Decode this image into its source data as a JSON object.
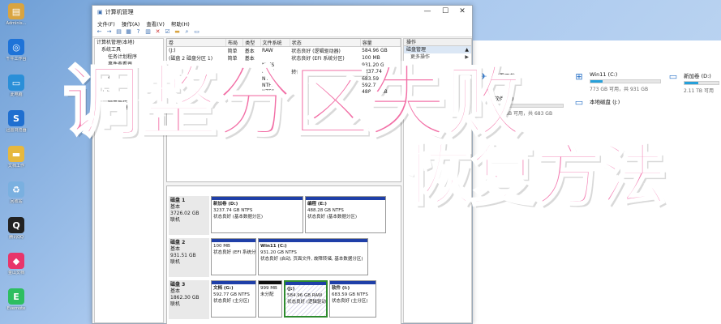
{
  "desktop_icons": [
    {
      "label": "Adminis...",
      "icon": "user-folder-icon",
      "color": "#d9a441",
      "glyph": "▤"
    },
    {
      "label": "千牛工作台",
      "icon": "qianniu-icon",
      "color": "#1e73d8",
      "glyph": "◎"
    },
    {
      "label": "此电脑",
      "icon": "computer-icon",
      "color": "#2a8fd8",
      "glyph": "▭"
    },
    {
      "label": "迅雷浏览器",
      "icon": "xunlei-browser-icon",
      "color": "#1f6fd0",
      "glyph": "S"
    },
    {
      "label": "文档工作",
      "icon": "folder-icon",
      "color": "#e6b83f",
      "glyph": "▬"
    },
    {
      "label": "回收站",
      "icon": "recycle-bin-icon",
      "color": "#7ab0e0",
      "glyph": "♻"
    },
    {
      "label": "腾讯QQ",
      "icon": "qq-icon",
      "color": "#222222",
      "glyph": "Q"
    },
    {
      "label": "金山文档",
      "icon": "kingsoft-docs-icon",
      "color": "#e8356b",
      "glyph": "◆"
    },
    {
      "label": "Evernote",
      "icon": "evernote-icon",
      "color": "#2dbe60",
      "glyph": "E"
    }
  ],
  "explorer": {
    "drives": [
      {
        "name": "迅雷下载",
        "capacity": "",
        "fill": 0,
        "icon": "xunlei-icon"
      },
      {
        "name": "Win11 (C:)",
        "capacity": "773 GB 可用，共 931 GB",
        "fill": 0.17,
        "icon": "windows-drive-icon"
      },
      {
        "name": "新加卷 (D:)",
        "capacity": "2.11 TB 可用",
        "fill": 0.4,
        "icon": "drive-icon"
      },
      {
        "name": "软件 (I:)",
        "capacity": "660 GB 可用，共 683 GB",
        "fill": 0.04,
        "icon": "drive-icon"
      },
      {
        "name": "本地磁盘 (J:)",
        "capacity": "",
        "fill": 0,
        "icon": "drive-icon"
      }
    ]
  },
  "window": {
    "title": "计算机管理",
    "menu": [
      "文件(F)",
      "操作(A)",
      "查看(V)",
      "帮助(H)"
    ],
    "tree": [
      "计算机管理(本地)",
      "系统工具",
      "任务计划程序",
      "事件查看器",
      "共享文件夹",
      "性能",
      "设备管理器",
      "存储",
      "磁盘管理",
      "服务和应用程序"
    ],
    "volume_table": {
      "headers": [
        "卷",
        "布局",
        "类型",
        "文件系统",
        "状态",
        "容量"
      ],
      "rows": [
        [
          "(J:)",
          "简单",
          "基本",
          "RAW",
          "状态良好 (逻辑驱动器)",
          "584.96 GB"
        ],
        [
          "(磁盘 2 磁盘分区 1)",
          "简单",
          "基本",
          "",
          "状态良好 (EFI 系统分区)",
          "100 MB"
        ],
        [
          "",
          "",
          "",
          "NTFS",
          "",
          "931.20 GB"
        ],
        [
          "",
          "",
          "",
          "NTFS",
          "转储",
          "3237.74 GB"
        ],
        [
          "",
          "",
          "",
          "NTFS",
          "",
          "683.59 GB"
        ],
        [
          "",
          "",
          "",
          "NTFS",
          "",
          "592.77 GB"
        ],
        [
          "",
          "",
          "",
          "NTFS",
          "",
          "488.28 GB"
        ]
      ]
    },
    "ops": {
      "header": "操作",
      "selected": "磁盘管理",
      "more": "更多操作"
    },
    "disks": [
      {
        "name": "磁盘 1",
        "type": "基本",
        "size": "3726.02 GB",
        "status": "联机",
        "parts": [
          {
            "title": "新加卷 (D:)",
            "size": "3237.74 GB NTFS",
            "status": "状态良好 (基本数据分区)"
          },
          {
            "title": "编程 (E:)",
            "size": "488.28 GB NTFS",
            "status": "状态良好 (基本数据分区)"
          }
        ]
      },
      {
        "name": "磁盘 2",
        "type": "基本",
        "size": "931.51 GB",
        "status": "联机",
        "parts": [
          {
            "title": "",
            "size": "100 MB",
            "status": "状态良好 (EFI 系统分区)"
          },
          {
            "title": "Win11 (C:)",
            "size": "931.20 GB NTFS",
            "status": "状态良好 (启动, 页面文件, 故障转储, 基本数据分区)"
          }
        ]
      },
      {
        "name": "磁盘 3",
        "type": "基本",
        "size": "1862.30 GB",
        "status": "联机",
        "parts": [
          {
            "title": "文档 (G:)",
            "size": "592.77 GB NTFS",
            "status": "状态良好 (主分区)"
          },
          {
            "title": "",
            "size": "999 MB",
            "status": "未分配"
          },
          {
            "title": "(J:)",
            "size": "584.96 GB RAW",
            "status": "状态良好 (逻辑驱动器)"
          },
          {
            "title": "软件 (I:)",
            "size": "683.59 GB NTFS",
            "status": "状态良好 (主分区)"
          }
        ]
      }
    ]
  },
  "overlay": {
    "line1": "调整分区失败",
    "line2": "恢复方法"
  }
}
